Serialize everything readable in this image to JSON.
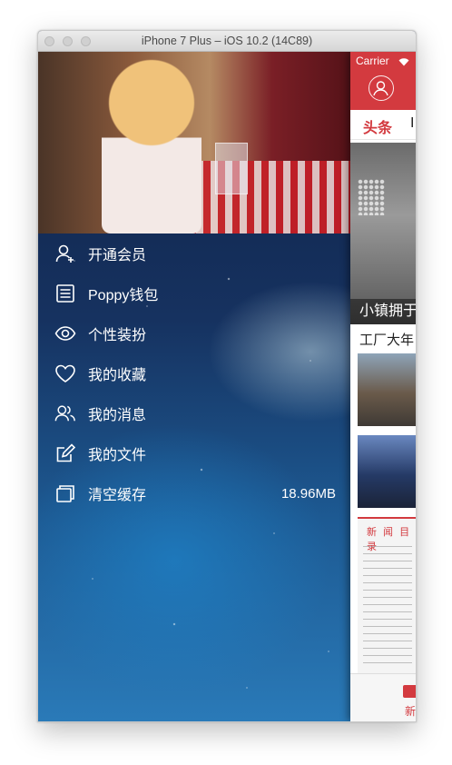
{
  "window": {
    "title": "iPhone 7 Plus – iOS 10.2 (14C89)"
  },
  "drawer": {
    "menu": [
      {
        "id": "vip",
        "label": "开通会员",
        "icon": "user-plus-icon"
      },
      {
        "id": "wallet",
        "label": "Poppy钱包",
        "icon": "wallet-list-icon"
      },
      {
        "id": "theme",
        "label": "个性装扮",
        "icon": "eye-icon"
      },
      {
        "id": "favorites",
        "label": "我的收藏",
        "icon": "heart-icon"
      },
      {
        "id": "messages",
        "label": "我的消息",
        "icon": "users-icon"
      },
      {
        "id": "files",
        "label": "我的文件",
        "icon": "edit-icon"
      },
      {
        "id": "cache",
        "label": "清空缓存",
        "icon": "layers-icon",
        "value": "18.96MB"
      }
    ]
  },
  "main": {
    "carrier": "Carrier",
    "tab_label": "头条",
    "tab_label_partial": "I",
    "headline_caption": "小镇拥于",
    "news2_title": "工厂大年",
    "doc_header": "新 闻 目 录",
    "bottom_tab_label": "新",
    "accent_color": "#d33a3f"
  }
}
